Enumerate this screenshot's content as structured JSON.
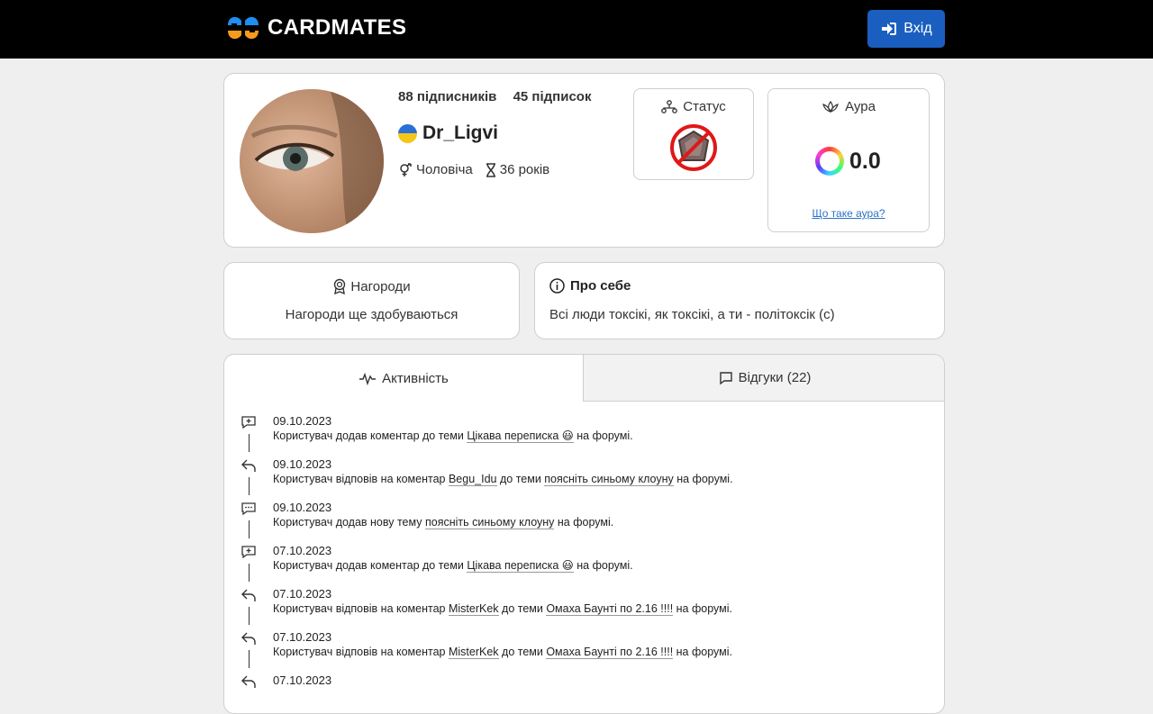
{
  "brand": {
    "name": "CARDMATES"
  },
  "header": {
    "login_label": "Вхід"
  },
  "profile": {
    "followers": "88 підписників",
    "following": "45 підписок",
    "username": "Dr_Ligvi",
    "gender": "Чоловіча",
    "age": "36 років",
    "status_title": "Статус",
    "aura_title": "Аура",
    "aura_value": "0.0",
    "aura_link": "Що таке аура?"
  },
  "awards": {
    "title": "Нагороди",
    "text": "Нагороди ще здобуваються"
  },
  "about": {
    "title": "Про себе",
    "text": "Всі люди токсікі, як токсікі, а ти - політоксік (с)"
  },
  "tabs": {
    "activity": "Активність",
    "reviews": "Відгуки (22)"
  },
  "feed": [
    {
      "icon": "comment-add-icon",
      "date": "09.10.2023",
      "a": "Користувач додав коментар до теми ",
      "link1": "Цікава переписка 😃",
      "b": " на форумі.",
      "link2": "",
      "c": ""
    },
    {
      "icon": "reply-icon",
      "date": "09.10.2023",
      "a": "Користувач відповів на коментар ",
      "link1": "Begu_Idu",
      "b": " до теми ",
      "link2": "поясніть синьому клоуну",
      "c": " на форумі."
    },
    {
      "icon": "topic-icon",
      "date": "09.10.2023",
      "a": "Користувач додав нову тему ",
      "link1": "поясніть синьому клоуну",
      "b": " на форумі.",
      "link2": "",
      "c": ""
    },
    {
      "icon": "comment-add-icon",
      "date": "07.10.2023",
      "a": "Користувач додав коментар до теми ",
      "link1": "Цікава переписка 😃",
      "b": " на форумі.",
      "link2": "",
      "c": ""
    },
    {
      "icon": "reply-icon",
      "date": "07.10.2023",
      "a": "Користувач відповів на коментар ",
      "link1": "MisterKek",
      "b": " до теми ",
      "link2": "Омаха Баунті по 2.16 !!!!",
      "c": " на форумі."
    },
    {
      "icon": "reply-icon",
      "date": "07.10.2023",
      "a": "Користувач відповів на коментар ",
      "link1": "MisterKek",
      "b": " до теми ",
      "link2": "Омаха Баунті по 2.16 !!!!",
      "c": " на форумі."
    },
    {
      "icon": "reply-icon",
      "date": "07.10.2023",
      "a": "",
      "link1": "",
      "b": "",
      "link2": "",
      "c": ""
    }
  ],
  "colors": {
    "topbar": "#000000",
    "login_button": "#1a5fbf",
    "link": "#2a74c8",
    "logo_blue": "#1e8ef0",
    "logo_orange": "#f59b1c"
  }
}
